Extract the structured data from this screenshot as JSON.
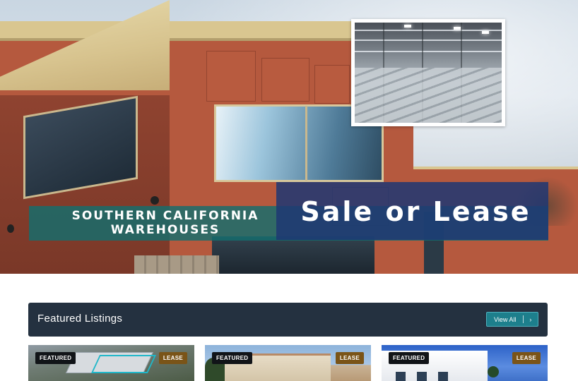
{
  "hero": {
    "banner_line1": "SOUTHERN CALIFORNIA",
    "banner_line2": "WAREHOUSES",
    "headline": "Sale or Lease"
  },
  "featured": {
    "title": "Featured Listings",
    "view_all_label": "View All",
    "view_all_icon": "chevron-right-icon"
  },
  "listings": [
    {
      "featured_badge": "FEATURED",
      "type_badge": "LEASE"
    },
    {
      "featured_badge": "FEATURED",
      "type_badge": "LEASE"
    },
    {
      "featured_badge": "FEATURED",
      "type_badge": "LEASE"
    }
  ],
  "colors": {
    "teal_band": "#146e6e",
    "blue_box": "#1e3773",
    "featured_bar": "#243140",
    "view_all_button": "#1d7f8c",
    "lease_badge": "#7a5418",
    "featured_badge": "#111418"
  }
}
